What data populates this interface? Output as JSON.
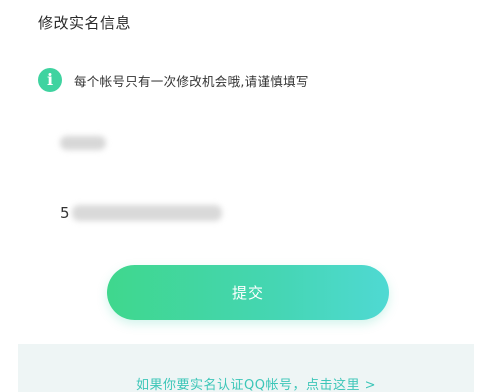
{
  "header": {
    "title": "修改实名信息"
  },
  "notice": {
    "icon": "info-icon",
    "icon_glyph": "i",
    "text": "每个帐号只有一次修改机会哦,请谨慎填写"
  },
  "form": {
    "id_number_visible_prefix": "5"
  },
  "submit": {
    "label": "提交"
  },
  "footer": {
    "link_text": "如果你要实名认证QQ帐号，点击这里 >"
  },
  "colors": {
    "accent_green": "#3fd3a0",
    "button_gradient_start": "#3fd78d",
    "button_gradient_end": "#4fd9d3",
    "footer_background": "#eef5f5",
    "footer_link": "#3cc6b8"
  }
}
